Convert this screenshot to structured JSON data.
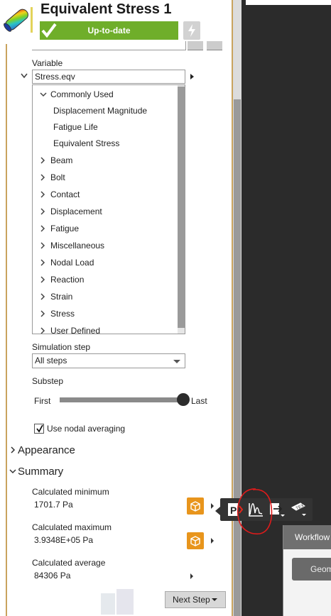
{
  "header": {
    "title": "Equivalent Stress 1",
    "status": "Up-to-date"
  },
  "variable": {
    "label": "Variable",
    "value": "Stress.eqv"
  },
  "tree": {
    "group": "Commonly Used",
    "group_items": [
      "Displacement Magnitude",
      "Fatigue Life",
      "Equivalent Stress"
    ],
    "categories": [
      "Beam",
      "Bolt",
      "Contact",
      "Displacement",
      "Fatigue",
      "Miscellaneous",
      "Nodal Load",
      "Reaction",
      "Strain",
      "Stress",
      "User Defined"
    ]
  },
  "simulation_step": {
    "label": "Simulation step",
    "value": "All steps"
  },
  "substep": {
    "label": "Substep",
    "first": "First",
    "last": "Last",
    "position": 1.0
  },
  "nodal_averaging": {
    "label": "Use nodal averaging",
    "checked": true
  },
  "sections": {
    "appearance": "Appearance",
    "summary": "Summary"
  },
  "summary": {
    "min_label": "Calculated minimum",
    "min_value": "1701.7 Pa",
    "max_label": "Calculated maximum",
    "max_value": "3.9348E+05 Pa",
    "avg_label": "Calculated average",
    "avg_value": "84306 Pa"
  },
  "next_step": "Next Step",
  "workflow": {
    "header": "Workflow",
    "button": "Geom"
  },
  "colors": {
    "status_green": "#6fae2a",
    "accent_orange": "#e8951c",
    "annotation_red": "#e01b1b"
  }
}
